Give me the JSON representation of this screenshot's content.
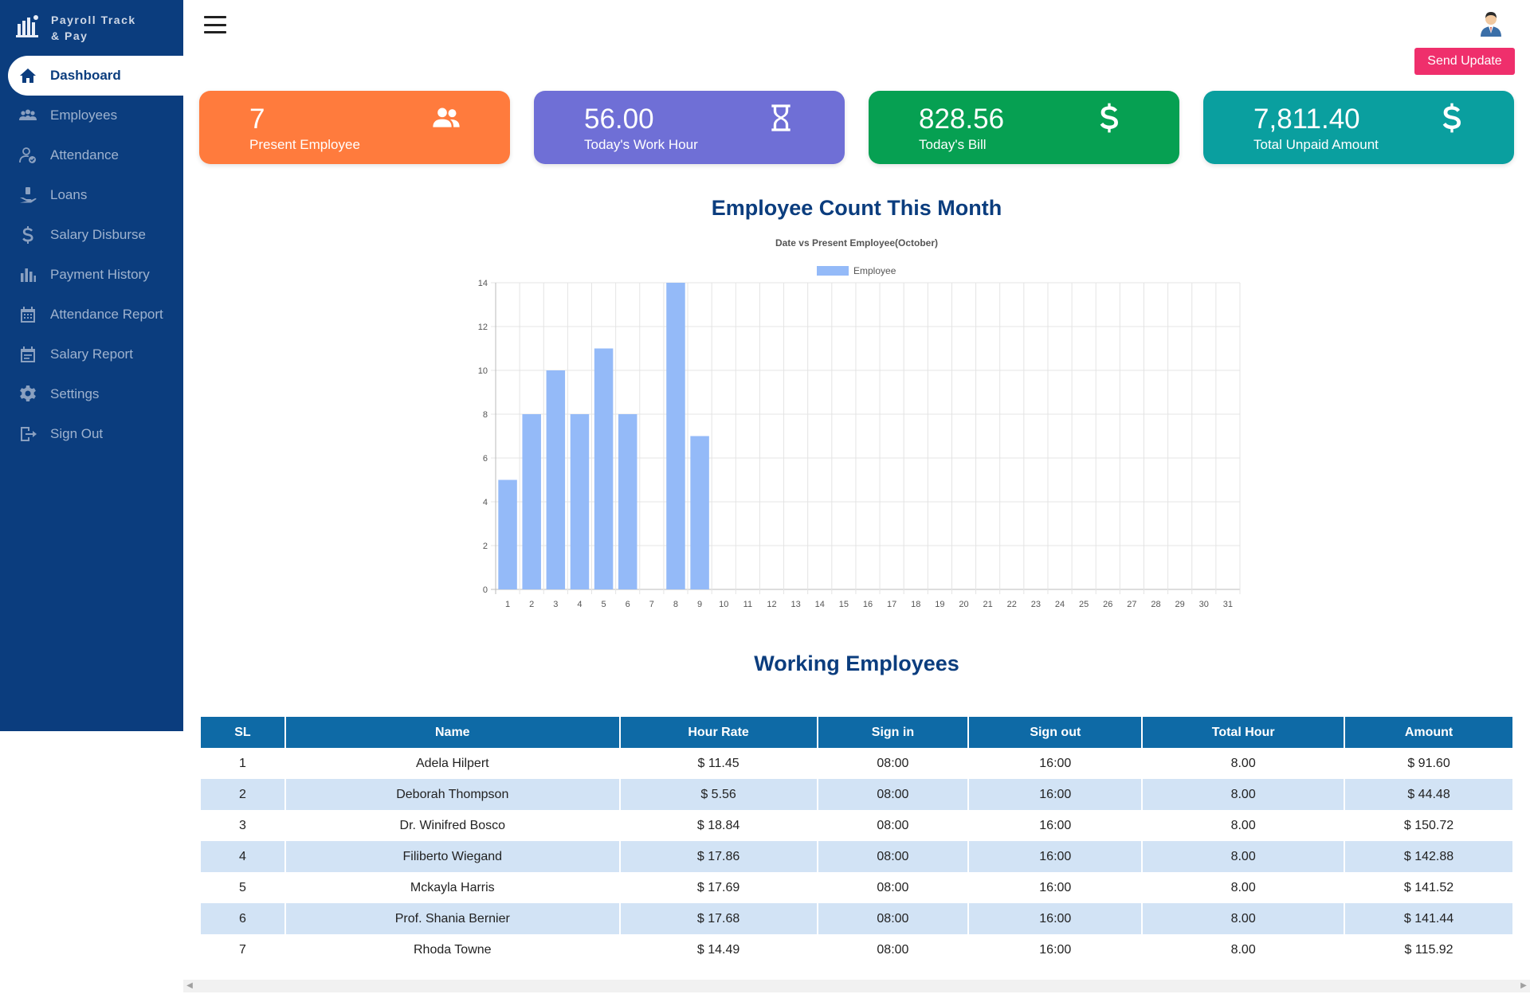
{
  "brand": {
    "name": "Payroll Track & Pay"
  },
  "sidebar": {
    "items": [
      {
        "label": "Dashboard",
        "icon": "home-icon",
        "active": true
      },
      {
        "label": "Employees",
        "icon": "users-icon"
      },
      {
        "label": "Attendance",
        "icon": "user-check-icon"
      },
      {
        "label": "Loans",
        "icon": "hand-money-icon"
      },
      {
        "label": "Salary Disburse",
        "icon": "dollar-icon"
      },
      {
        "label": "Payment History",
        "icon": "bar-chart-icon"
      },
      {
        "label": "Attendance Report",
        "icon": "calendar-icon"
      },
      {
        "label": "Salary Report",
        "icon": "calendar-list-icon"
      },
      {
        "label": "Settings",
        "icon": "gear-icon"
      },
      {
        "label": "Sign Out",
        "icon": "sign-out-icon"
      }
    ]
  },
  "topbar": {
    "send_update_label": "Send Update"
  },
  "cards": [
    {
      "value": "7",
      "label": "Present Employee",
      "icon": "users-icon",
      "color": "#ff7b3d"
    },
    {
      "value": "56.00",
      "label": "Today's Work Hour",
      "icon": "hourglass-icon",
      "color": "#6f6fd6"
    },
    {
      "value": "828.56",
      "label": "Today's Bill",
      "icon": "dollar-icon",
      "color": "#06a052"
    },
    {
      "value": "7,811.40",
      "label": "Total Unpaid Amount",
      "icon": "dollar-icon",
      "color": "#0a9f9f"
    }
  ],
  "chart_section_title": "Employee Count This Month",
  "chart_data": {
    "type": "bar",
    "title": "Date vs Present Employee(October)",
    "legend": "top",
    "series": [
      {
        "name": "Employee",
        "values": [
          5,
          8,
          10,
          8,
          11,
          8,
          0,
          14,
          7,
          0,
          0,
          0,
          0,
          0,
          0,
          0,
          0,
          0,
          0,
          0,
          0,
          0,
          0,
          0,
          0,
          0,
          0,
          0,
          0,
          0,
          0
        ]
      }
    ],
    "categories": [
      "1",
      "2",
      "3",
      "4",
      "5",
      "6",
      "7",
      "8",
      "9",
      "10",
      "11",
      "12",
      "13",
      "14",
      "15",
      "16",
      "17",
      "18",
      "19",
      "20",
      "21",
      "22",
      "23",
      "24",
      "25",
      "26",
      "27",
      "28",
      "29",
      "30",
      "31"
    ],
    "ylim": [
      0,
      14
    ],
    "yticks": [
      0,
      2,
      4,
      6,
      8,
      10,
      12,
      14
    ],
    "grid": true,
    "bar_color": "#94baf8"
  },
  "table_section_title": "Working Employees",
  "table": {
    "headers": [
      "SL",
      "Name",
      "Hour Rate",
      "Sign in",
      "Sign out",
      "Total Hour",
      "Amount"
    ],
    "rows": [
      [
        "1",
        "Adela Hilpert",
        "$ 11.45",
        "08:00",
        "16:00",
        "8.00",
        "$ 91.60"
      ],
      [
        "2",
        "Deborah Thompson",
        "$ 5.56",
        "08:00",
        "16:00",
        "8.00",
        "$ 44.48"
      ],
      [
        "3",
        "Dr. Winifred Bosco",
        "$ 18.84",
        "08:00",
        "16:00",
        "8.00",
        "$ 150.72"
      ],
      [
        "4",
        "Filiberto Wiegand",
        "$ 17.86",
        "08:00",
        "16:00",
        "8.00",
        "$ 142.88"
      ],
      [
        "5",
        "Mckayla Harris",
        "$ 17.69",
        "08:00",
        "16:00",
        "8.00",
        "$ 141.52"
      ],
      [
        "6",
        "Prof. Shania Bernier",
        "$ 17.68",
        "08:00",
        "16:00",
        "8.00",
        "$ 141.44"
      ],
      [
        "7",
        "Rhoda Towne",
        "$ 14.49",
        "08:00",
        "16:00",
        "8.00",
        "$ 115.92"
      ]
    ]
  }
}
